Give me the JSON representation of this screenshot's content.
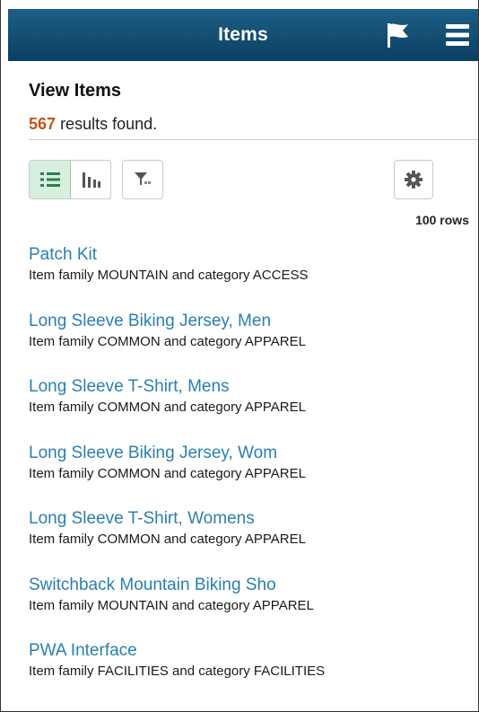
{
  "header": {
    "title": "Items",
    "flag_icon": "flag-icon",
    "menu_icon": "hamburger-menu-icon",
    "bg_color": "#0f4a70"
  },
  "page": {
    "title": "View Items",
    "results_count": "567",
    "results_text": "results found."
  },
  "toolbar": {
    "list_view_icon": "list-view-icon",
    "chart_view_icon": "chart-view-icon",
    "filter_icon": "filter-icon",
    "settings_icon": "gear-icon",
    "rows_label": "100 rows",
    "active_view": "list"
  },
  "items": [
    {
      "name": "Patch Kit",
      "desc": "Item family MOUNTAIN and category ACCESS"
    },
    {
      "name": "Long Sleeve Biking Jersey, Men",
      "desc": "Item family COMMON and category APPAREL"
    },
    {
      "name": "Long Sleeve T-Shirt, Mens",
      "desc": "Item family COMMON and category APPAREL"
    },
    {
      "name": "Long Sleeve Biking Jersey, Wom",
      "desc": "Item family COMMON and category APPAREL"
    },
    {
      "name": "Long Sleeve T-Shirt, Womens",
      "desc": "Item family COMMON and category APPAREL"
    },
    {
      "name": "Switchback Mountain Biking Sho",
      "desc": "Item family MOUNTAIN and category APPAREL"
    },
    {
      "name": "PWA Interface",
      "desc": "Item family FACILITIES and category FACILITIES"
    }
  ],
  "colors": {
    "accent_link": "#2a7fb0",
    "count": "#c0551b",
    "active_toggle": "#d6f0dd"
  }
}
